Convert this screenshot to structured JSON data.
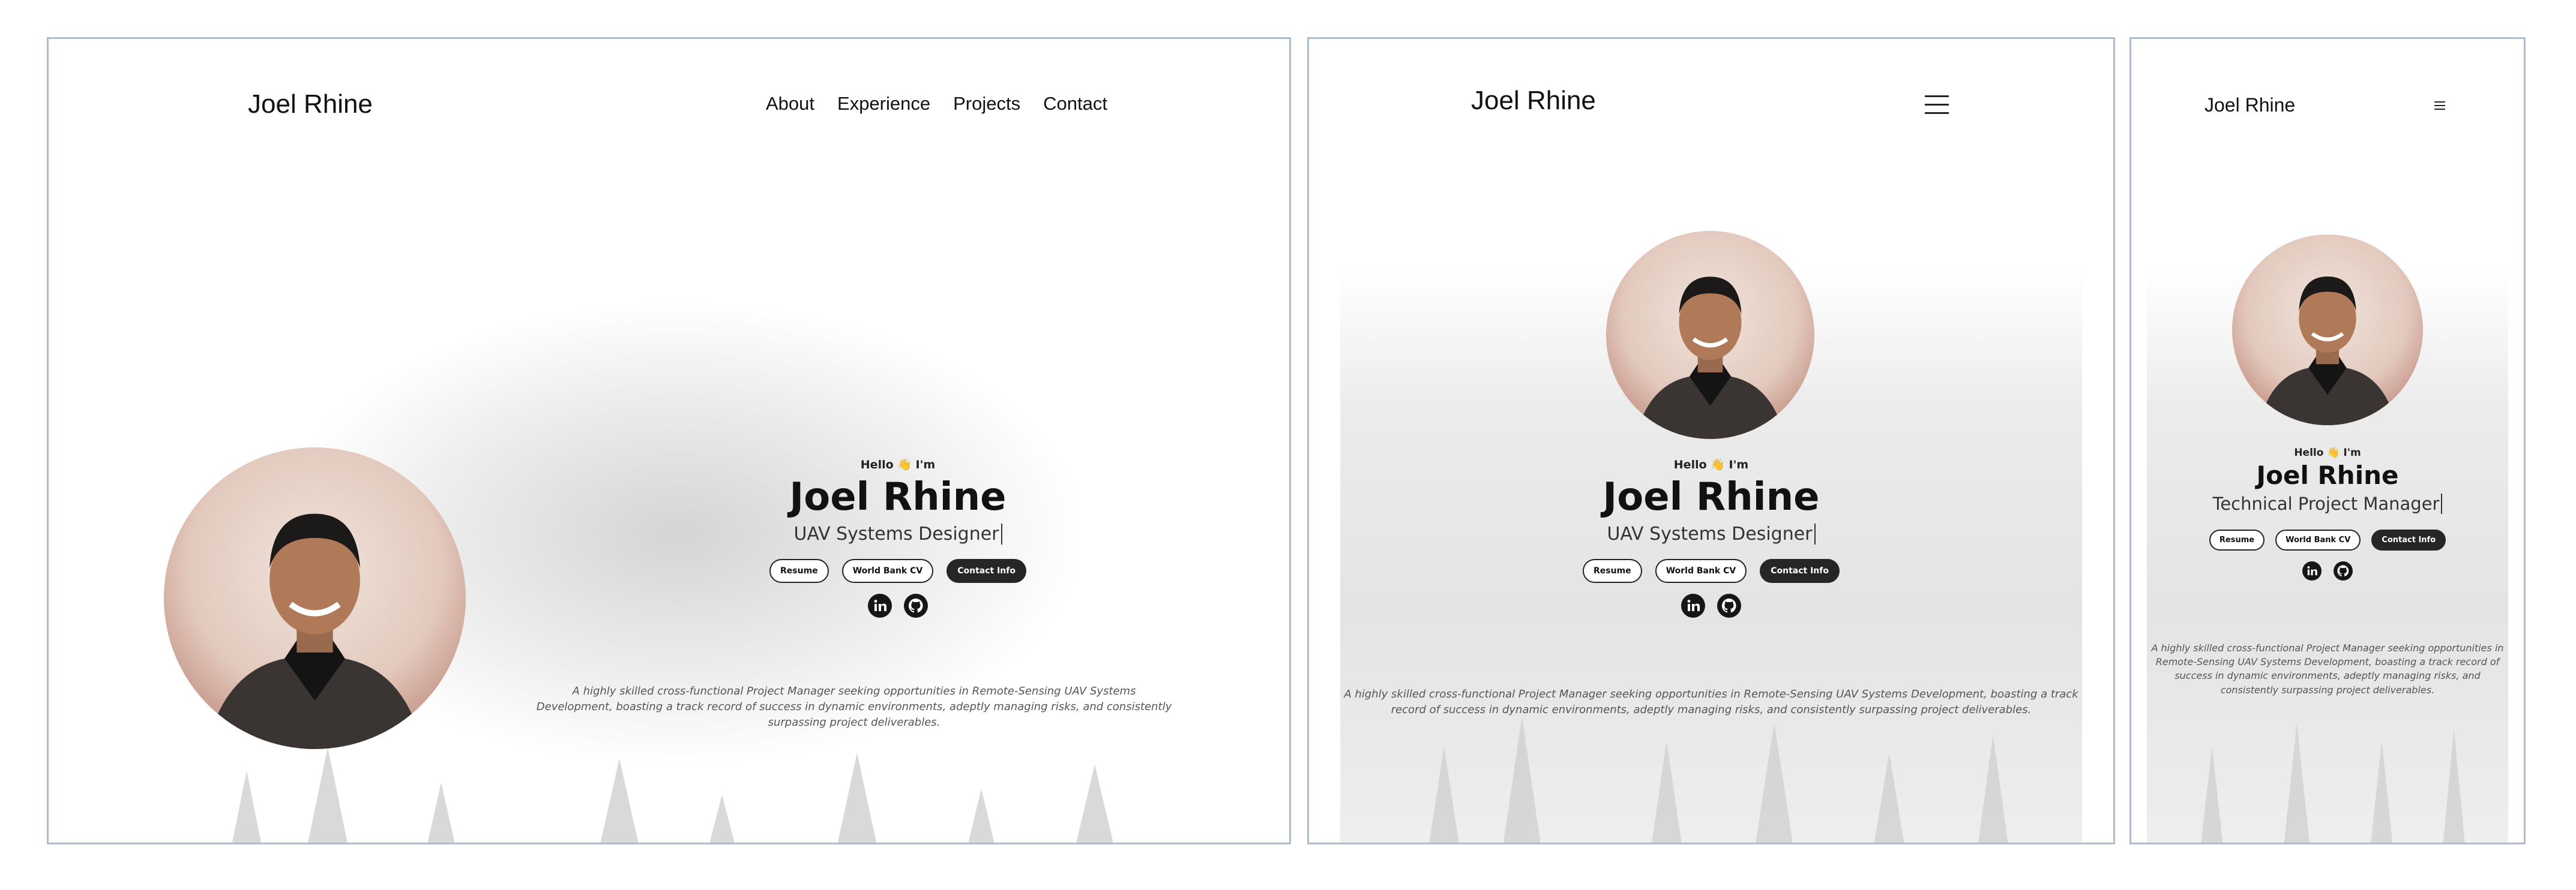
{
  "brand": "Joel Rhine",
  "nav": {
    "items": [
      "About",
      "Experience",
      "Projects",
      "Contact"
    ]
  },
  "hero": {
    "greeting": "Hello 👋 I'm",
    "name": "Joel Rhine",
    "roles": {
      "desktop": "UAV Systems Designer",
      "tablet": "UAV Systems Designer",
      "mobile": "Technical Project Manager"
    },
    "buttons": {
      "resume": "Resume",
      "world_bank_cv": "World Bank CV",
      "contact_info": "Contact Info"
    },
    "socials": [
      "linkedin-icon",
      "github-icon"
    ]
  },
  "bio": "A highly skilled cross-functional Project Manager seeking opportunities in Remote-Sensing UAV Systems Development, boasting a track record of success in dynamic environments, adeptly managing risks, and consistently surpassing project deliverables.",
  "colors": {
    "frame_border": "#aebccc",
    "button_dark": "#262626",
    "text": "#111111"
  }
}
